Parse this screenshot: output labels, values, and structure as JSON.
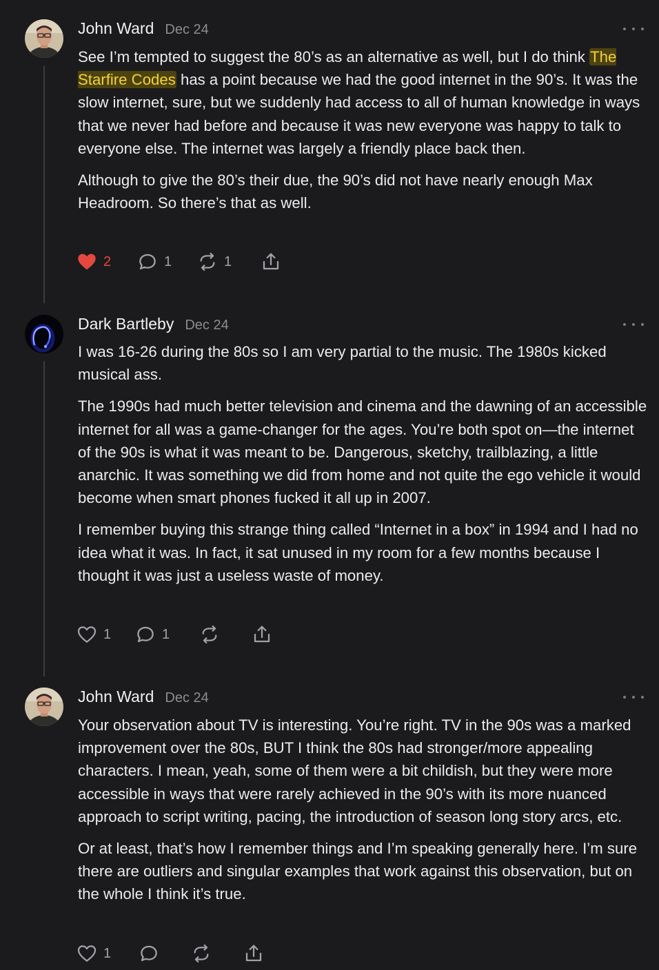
{
  "comments": [
    {
      "author": "John Ward",
      "date": "Dec 24",
      "avatar": "john-ward-avatar",
      "paragraphs": [
        {
          "before": "See I’m tempted to suggest the 80’s as an alternative as well, but I do think ",
          "mention": "The Starfire Codes",
          "after": " has a point because we had the good internet in the 90’s. It was the slow internet, sure, but we suddenly had access to all of human knowledge in ways that we never had before and because it was new everyone was happy to talk to everyone else. The internet was largely a friendly place back then."
        },
        {
          "text": "Although to give the 80’s their due, the 90’s did not have nearly enough Max Headroom. So there’s that as well."
        }
      ],
      "likes": "2",
      "liked": true,
      "replies": "1",
      "restacks": "1"
    },
    {
      "author": "Dark Bartleby",
      "date": "Dec 24",
      "avatar": "dark-bartleby-avatar",
      "paragraphs": [
        {
          "text": "I was 16-26 during the 80s so I am very partial to the music. The 1980s kicked musical ass."
        },
        {
          "text": "The 1990s had much better television and cinema and the dawning of an accessible internet for all was a game-changer for the ages. You’re both spot on—the internet of the 90s is what it was meant to be. Dangerous, sketchy, trailblazing, a little anarchic. It was something we did from home and not quite the ego vehicle it would become when smart phones fucked it all up in 2007."
        },
        {
          "text": "I remember buying this strange thing called “Internet in a box” in 1994 and I had no idea what it was. In fact, it sat unused in my room for a few months because I thought it was just a useless waste of money."
        }
      ],
      "likes": "1",
      "liked": false,
      "replies": "1",
      "restacks": ""
    },
    {
      "author": "John Ward",
      "date": "Dec 24",
      "avatar": "john-ward-avatar",
      "paragraphs": [
        {
          "text": "Your observation about TV is interesting. You’re right. TV in the 90s was a marked improvement over the 80s, BUT I think the 80s had stronger/more appealing characters. I mean, yeah, some of them were a bit childish, but they were more accessible in ways that were rarely achieved in the 90’s with its more nuanced approach to script writing, pacing, the introduction of season long story arcs, etc."
        },
        {
          "text": "Or at least, that’s how I remember things and I’m speaking generally here. I’m sure there are outliers and singular examples that work against this observation, but on the whole I think it’s true."
        }
      ],
      "likes": "1",
      "liked": false,
      "replies": "",
      "restacks": ""
    }
  ],
  "icons": {
    "like": "heart-icon",
    "reply": "comment-bubble-icon",
    "restack": "restack-icon",
    "share": "share-icon",
    "more": "more-options-icon"
  },
  "colors": {
    "background": "#1b1b1d",
    "text": "#ececee",
    "muted": "#8c8c92",
    "liked": "#e5483f",
    "mention_text": "#f2d23a",
    "mention_bg": "#4d4310"
  }
}
